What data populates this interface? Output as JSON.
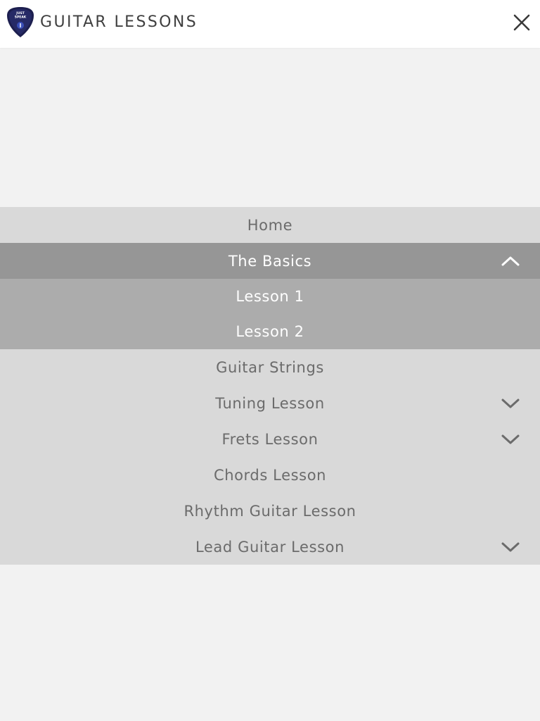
{
  "header": {
    "title": "GUITAR LESSONS",
    "logo_icon": "guitar-pick-logo-icon",
    "logo_text_line1": "JUST",
    "logo_text_line2": "SPEAK",
    "close_icon": "close-icon"
  },
  "menu": {
    "items": [
      {
        "label": "Home"
      },
      {
        "label": "The Basics",
        "expanded": true,
        "icon": "chevron-up-icon"
      },
      {
        "label": "Lesson 1",
        "submenu": true
      },
      {
        "label": "Lesson 2",
        "submenu": true
      },
      {
        "label": "Guitar Strings"
      },
      {
        "label": "Tuning Lesson",
        "expanded": false,
        "icon": "chevron-down-icon"
      },
      {
        "label": "Frets Lesson",
        "expanded": false,
        "icon": "chevron-down-icon"
      },
      {
        "label": "Chords Lesson"
      },
      {
        "label": "Rhythm Guitar Lesson"
      },
      {
        "label": "Lead Guitar Lesson",
        "expanded": false,
        "icon": "chevron-down-icon"
      }
    ]
  },
  "colors": {
    "header_bg": "#ffffff",
    "page_bg": "#f2f2f2",
    "menu_item_bg": "#d9d9d9",
    "menu_active_bg": "#969696",
    "submenu_bg": "#acacac",
    "menu_text": "#6b6b6b",
    "menu_text_light": "#ffffff",
    "logo_navy": "#1d1f4f"
  }
}
